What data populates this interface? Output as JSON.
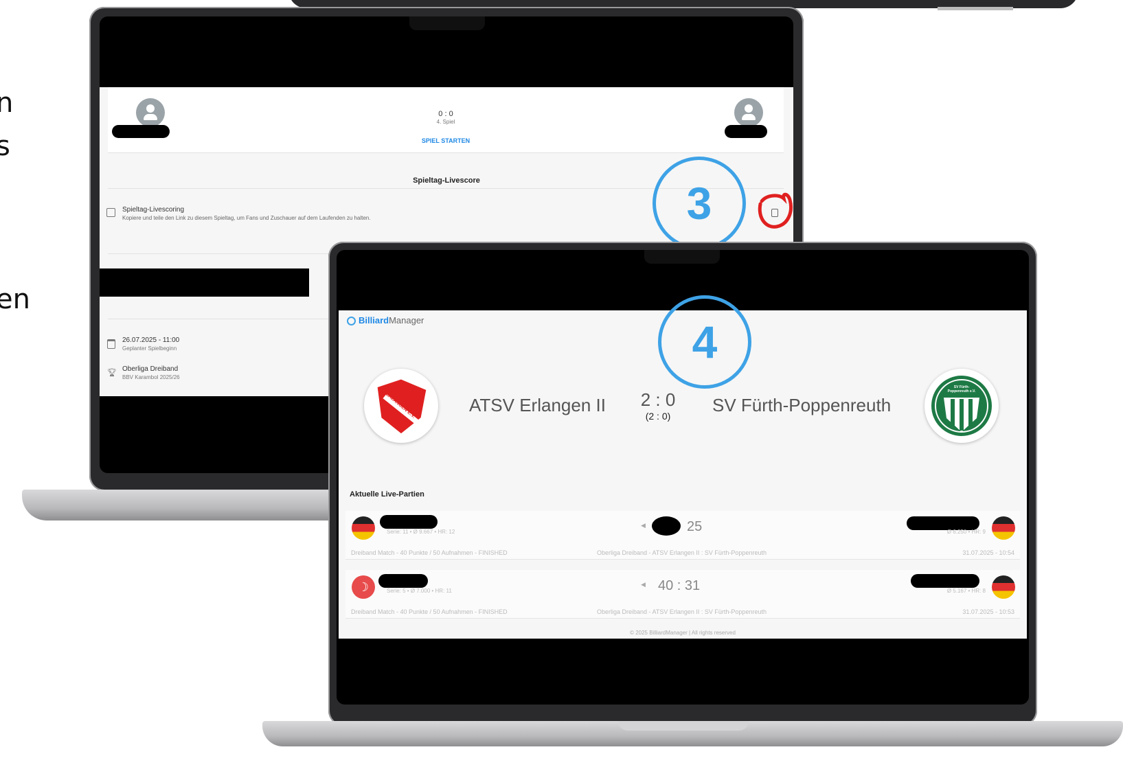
{
  "side_fragments": [
    "n",
    "s",
    "en"
  ],
  "back_laptop": {
    "score": "0 : 0",
    "game_label": "4. Spiel",
    "start_button": "SPIEL STARTEN",
    "section_title": "Spieltag-Livescore",
    "live_title": "Spieltag-Livescoring",
    "live_desc": "Kopiere und teile den Link zu diesem Spieltag, um Fans und Zuschauer auf dem Laufenden zu halten.",
    "date": "26.07.2025 - 11:00",
    "date_label": "Geplanter Spielbeginn",
    "league": "Oberliga Dreiband",
    "league_sub": "BBV Karambol 2025/26"
  },
  "markers": {
    "step3": "3",
    "step4": "4"
  },
  "front_laptop": {
    "brand_bold": "Billiard",
    "brand_rest": "Manager",
    "home_team": "ATSV Erlangen II",
    "away_team": "SV Fürth-Poppenreuth",
    "score": "2 : 0",
    "score_sub": "(2 : 0)",
    "home_logo_text": "ATSV 1898 ERLANGEN E.V.",
    "away_logo_text": "SV Fürth-Poppenreuth e.V.",
    "section_title": "Aktuelle Live-Partien",
    "matches": [
      {
        "left_stats": "Serie: 11 • Ø 9.667 • HR: 12",
        "score": "25",
        "right_stats": "Ø 6.250 • HR: 9",
        "meta_left": "Dreiband Match - 40 Punkte / 50 Aufnahmen - FINISHED",
        "meta_mid": "Oberliga Dreiband - ATSV Erlangen II : SV Fürth-Poppenreuth",
        "meta_right": "31.07.2025 - 10:54"
      },
      {
        "left_stats": "Serie: 5 • Ø 7.000 • HR: 11",
        "score": "40 : 31",
        "right_stats": "Ø 5.167 • HR: 8",
        "meta_left": "Dreiband Match - 40 Punkte / 50 Aufnahmen - FINISHED",
        "meta_mid": "Oberliga Dreiband - ATSV Erlangen II : SV Fürth-Poppenreuth",
        "meta_right": "31.07.2025 - 10:53"
      }
    ],
    "footer": "© 2025 BilliardManager | All rights reserved"
  },
  "colors": {
    "accent_blue": "#3ea2e6",
    "link_blue": "#1e88e5",
    "red": "#e02020",
    "green": "#1e7a45"
  }
}
